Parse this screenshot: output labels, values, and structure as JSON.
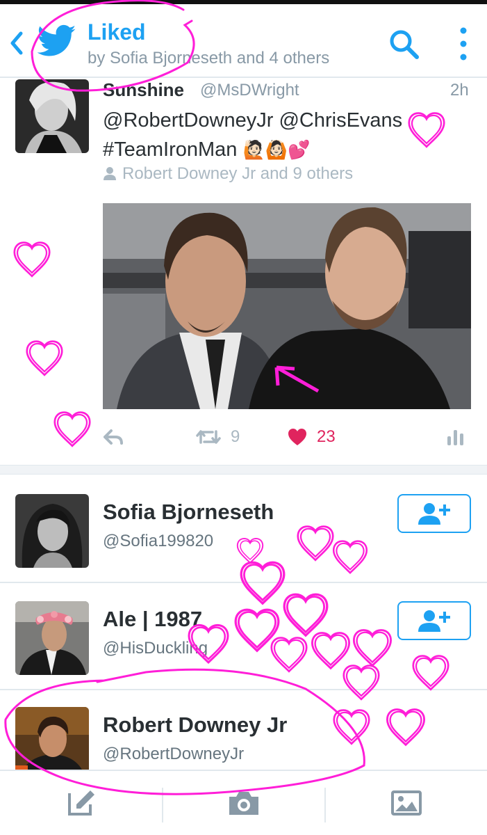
{
  "header": {
    "title": "Liked",
    "subtitle": "by Sofia Bjorneseth and 4 others"
  },
  "tweet": {
    "name": "Sunshine",
    "handle": "@MsDWright",
    "time": "2h",
    "text_line1": "@RobertDowneyJr @ChrisEvans",
    "text_line2": "#TeamIronMan",
    "emojis": "🙋🏻🙆🏻💕",
    "liked_by": "Robert Downey Jr and 9 others",
    "retweets": "9",
    "likes": "23"
  },
  "users": [
    {
      "name": "Sofia Bjorneseth",
      "handle": "@Sofia199820",
      "follow": true
    },
    {
      "name": "Ale | 1987",
      "handle": "@HisDuckling",
      "follow": true
    },
    {
      "name": "Robert Downey Jr",
      "handle": "@RobertDowneyJr",
      "follow": false
    }
  ],
  "colors": {
    "accent": "#1da1f2",
    "like": "#e0245e",
    "annotation": "#ff1ed8"
  },
  "icons": {
    "back": "chevron-left-icon",
    "logo": "twitter-bird-icon",
    "search": "search-icon",
    "more": "more-vertical-icon",
    "follow": "add-user-icon",
    "compose": "compose-icon",
    "camera": "camera-icon",
    "image": "image-icon"
  }
}
